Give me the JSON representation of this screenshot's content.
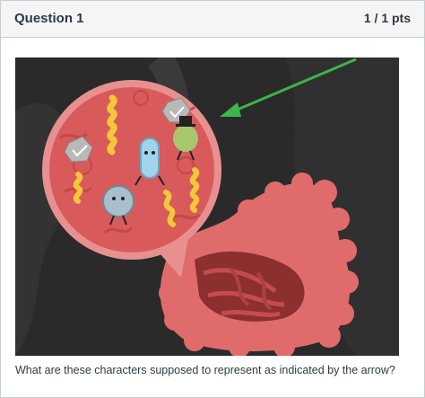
{
  "question": {
    "title": "Question 1",
    "points": "1 / 1 pts",
    "text": "What are these characters supposed to represent as indicated by the arrow?"
  },
  "illustration": {
    "subject": "cartoon-microbes-in-intestine",
    "colors": {
      "background": "#2a2a2a",
      "intestine": "#e06b6b",
      "magnifier": "#d85a5a",
      "arrow": "#3cb54a"
    }
  }
}
